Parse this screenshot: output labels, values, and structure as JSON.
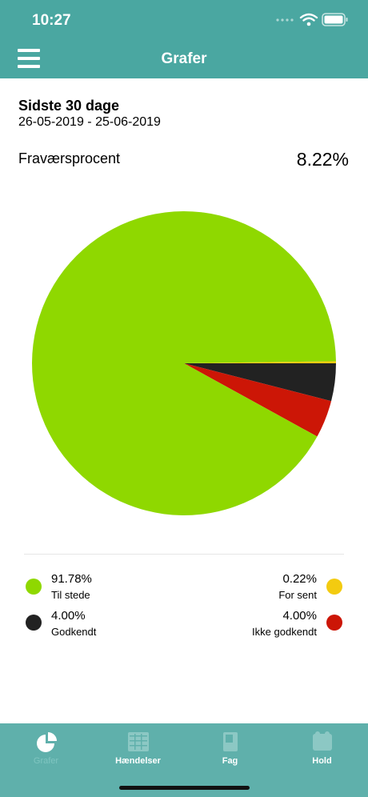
{
  "status": {
    "time": "10:27"
  },
  "nav": {
    "title": "Grafer",
    "menu_icon": "hamburger-menu-icon"
  },
  "period": {
    "title": "Sidste 30 dage",
    "range": "26-05-2019 - 25-06-2019"
  },
  "absence": {
    "label": "Fraværsprocent",
    "value": "8.22%"
  },
  "chart_data": {
    "type": "pie",
    "categories": [
      "Til stede",
      "For sent",
      "Godkendt",
      "Ikke godkendt"
    ],
    "values": [
      91.78,
      0.22,
      4.0,
      4.0
    ],
    "colors": [
      "#8fd800",
      "#f3cb10",
      "#222222",
      "#cc1606"
    ]
  },
  "legend": [
    {
      "percent": "91.78%",
      "label": "Til stede",
      "color": "#8fd800"
    },
    {
      "percent": "0.22%",
      "label": "For sent",
      "color": "#f3cb10"
    },
    {
      "percent": "4.00%",
      "label": "Godkendt",
      "color": "#222222"
    },
    {
      "percent": "4.00%",
      "label": "Ikke godkendt",
      "color": "#cc1606"
    }
  ],
  "tabs": [
    {
      "label": "Grafer",
      "icon": "pie-chart-icon",
      "active": true
    },
    {
      "label": "Hændelser",
      "icon": "calendar-grid-icon",
      "active": false
    },
    {
      "label": "Fag",
      "icon": "book-icon",
      "active": false
    },
    {
      "label": "Hold",
      "icon": "group-icon",
      "active": false
    }
  ]
}
